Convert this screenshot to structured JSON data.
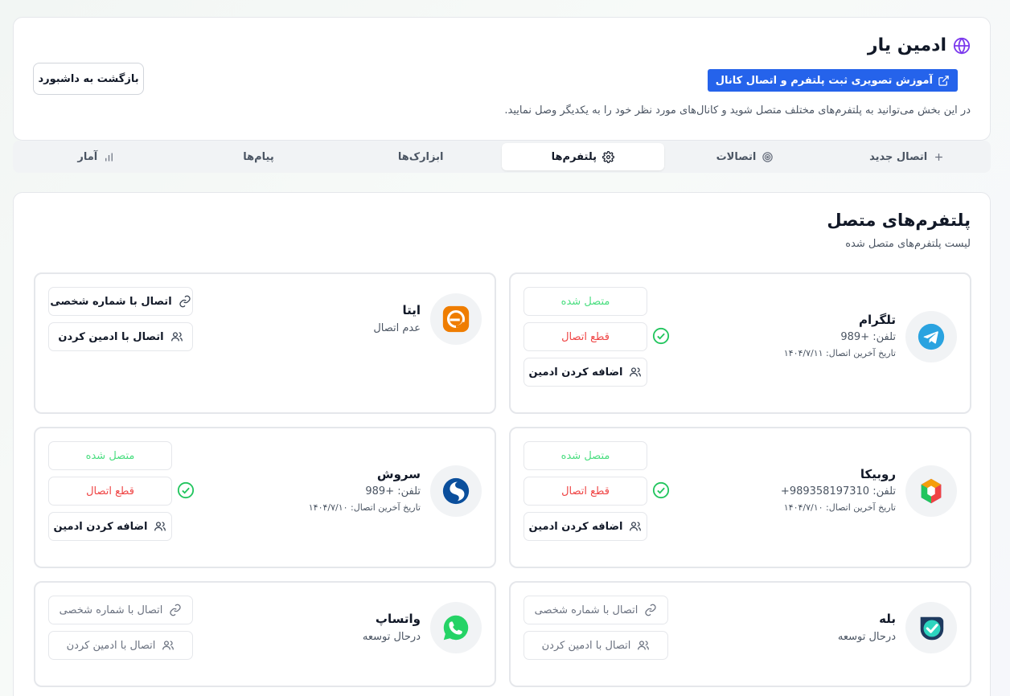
{
  "header": {
    "title": "ادمین یار",
    "tutorial_label": "آموزش تصویری ثبت پلتفرم و اتصال کانال",
    "description": "در این بخش می‌توانید به پلتفرم‌های مختلف متصل شوید و کانال‌های مورد نظر خود را به یکدیگر وصل نمایید.",
    "back_label": "بازگشت به داشبورد"
  },
  "tabs": [
    {
      "label": "اتصال جدید",
      "icon": "plus-icon",
      "active": false
    },
    {
      "label": "اتصالات",
      "icon": "target-icon",
      "active": false
    },
    {
      "label": "پلتفرم‌ها",
      "icon": "gear-icon",
      "active": true
    },
    {
      "label": "ابزارک‌ها",
      "icon": "",
      "active": false
    },
    {
      "label": "پیام‌ها",
      "icon": "",
      "active": false
    },
    {
      "label": "آمار",
      "icon": "bar-chart-icon",
      "active": false
    }
  ],
  "main": {
    "title": "پلتفرم‌های متصل",
    "subtitle": "لیست پلتفرم‌های متصل شده"
  },
  "platforms": {
    "telegram": {
      "name": "تلگرام",
      "phone": "تلفن: +989",
      "last_conn": "تاریخ آخرین اتصال: ۱۴۰۴/۷/۱۱",
      "connected": "متصل شده",
      "disconnect": "قطع اتصال",
      "add_admin": "اضافه کردن ادمین"
    },
    "eitaa": {
      "name": "ایتا",
      "status": "عدم اتصال",
      "personal": "اتصال با شماره شخصی",
      "by_admin": "اتصال با ادمین کردن"
    },
    "rubika": {
      "name": "روبیکا",
      "phone": "تلفن: 989358197310+",
      "last_conn": "تاریخ آخرین اتصال: ۱۴۰۴/۷/۱۰",
      "connected": "متصل شده",
      "disconnect": "قطع اتصال",
      "add_admin": "اضافه کردن ادمین"
    },
    "soroush": {
      "name": "سروش",
      "phone": "تلفن: +989",
      "last_conn": "تاریخ آخرین اتصال: ۱۴۰۴/۷/۱۰",
      "connected": "متصل شده",
      "disconnect": "قطع اتصال",
      "add_admin": "اضافه کردن ادمین"
    },
    "bale": {
      "name": "بله",
      "status": "درحال توسعه",
      "personal": "اتصال با شماره شخصی",
      "by_admin": "اتصال با ادمین کردن"
    },
    "whatsapp": {
      "name": "واتساپ",
      "status": "درحال توسعه",
      "personal": "اتصال با شماره شخصی",
      "by_admin": "اتصال با ادمین کردن"
    }
  },
  "colors": {
    "accent": "#2563eb",
    "success": "#4ade80",
    "danger": "#ef4444",
    "check": "#22c55e"
  }
}
